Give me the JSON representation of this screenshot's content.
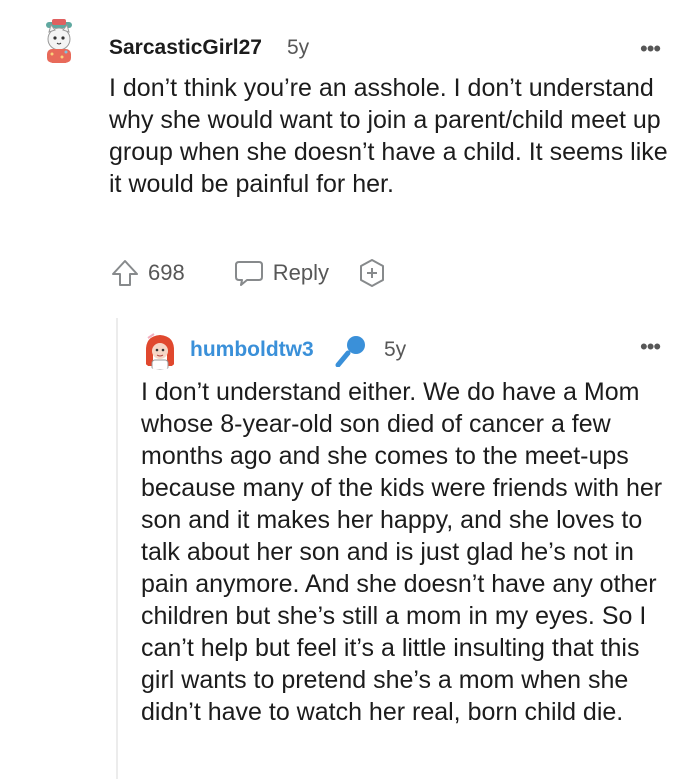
{
  "comments": [
    {
      "username": "SarcasticGirl27",
      "time": "5y",
      "text": "I don’t think you’re an asshole. I don’t understand why she would want to join a parent/child meet up group when she doesn’t have a child. It seems like it would be painful for her.",
      "votes": "698",
      "reply_label": "Reply",
      "avatar_icon": "cat-avatar-icon"
    },
    {
      "username": "humboldtw3",
      "time": "5y",
      "username_color": "#3a90d9",
      "text": "I don’t understand either. We do have a Mom whose 8-year-old son died of cancer a few months ago and she comes to the meet-ups because many of the kids were friends with her son and it makes her happy, and she loves to talk about her son and is just glad he’s not in pain anymore. And she doesn’t have any other children but she’s still a mom in my eyes. So I can’t help but feel it’s a little insulting that this girl wants to pretend she’s a mom when she didn’t have to watch her real, born child die.",
      "avatar_icon": "red-hair-avatar-icon",
      "flair_icon": "microphone-icon"
    }
  ]
}
